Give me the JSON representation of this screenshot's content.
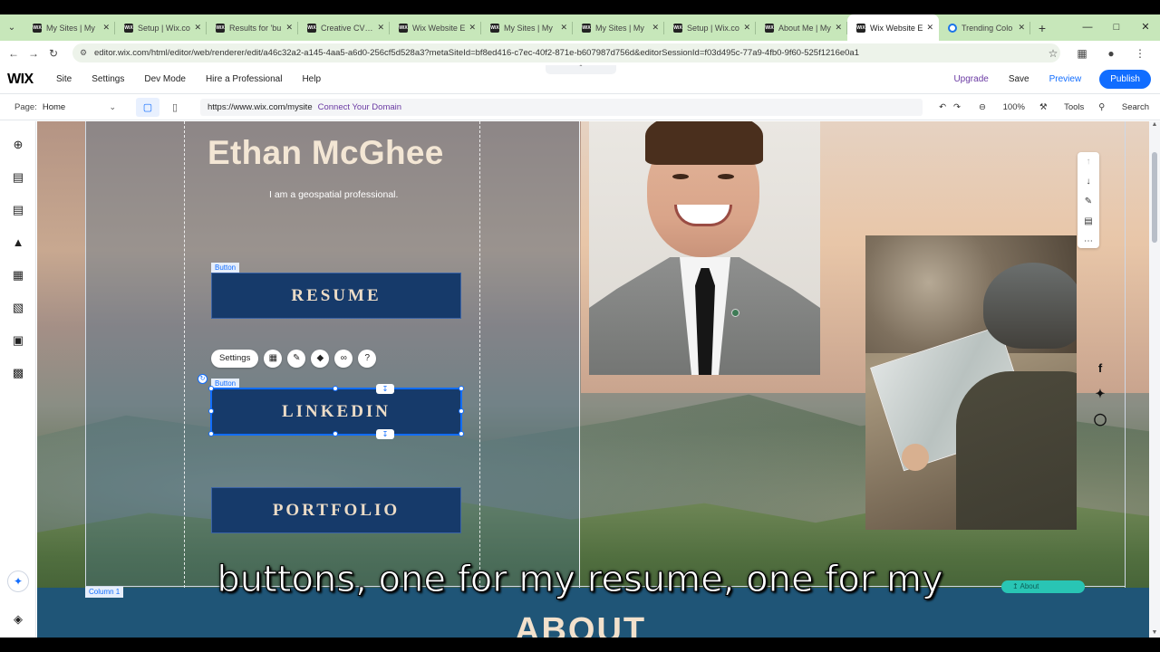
{
  "browser": {
    "tabs": [
      {
        "label": "My Sites | My",
        "fav": "WiX"
      },
      {
        "label": "Setup | Wix.co",
        "fav": "WiX"
      },
      {
        "label": "Results for 'bu",
        "fav": "WiX"
      },
      {
        "label": "Creative CV W",
        "fav": "WiX"
      },
      {
        "label": "Wix Website E",
        "fav": "WiX"
      },
      {
        "label": "My Sites | My",
        "fav": "WiX"
      },
      {
        "label": "My Sites | My",
        "fav": "WiX"
      },
      {
        "label": "Setup | Wix.co",
        "fav": "WiX"
      },
      {
        "label": "About Me | My",
        "fav": "WiX"
      },
      {
        "label": "Wix Website E",
        "fav": "WiX",
        "active": true
      },
      {
        "label": "Trending Colo",
        "fav": ""
      }
    ],
    "url": "editor.wix.com/html/editor/web/renderer/edit/a46c32a2-a145-4aa5-a6d0-256cf5d528a3?metaSiteId=bf8ed416-c7ec-40f2-871e-b607987d756d&editorSessionId=f03d495c-77a9-4fb0-9f60-525f1216e0a1"
  },
  "wix": {
    "logo": "WIX",
    "menu": [
      "Site",
      "Settings",
      "Dev Mode",
      "Hire a Professional",
      "Help"
    ],
    "upgrade": "Upgrade",
    "save": "Save",
    "preview": "Preview",
    "publish": "Publish"
  },
  "pagebar": {
    "page_label": "Page:",
    "page_value": "Home",
    "site_url": "https://www.wix.com/mysite",
    "connect_domain": "Connect Your Domain",
    "zoom": "100%",
    "tools": "Tools",
    "search": "Search"
  },
  "site": {
    "name": "Ethan McGhee",
    "tagline": "I am a geospatial professional.",
    "buttons": {
      "resume": "RESUME",
      "linkedin": "LINKEDIN",
      "portfolio": "PORTFOLIO"
    },
    "element_label_1": "Button",
    "element_label_2": "Button",
    "about_title": "ABOUT",
    "column_label": "Column 1",
    "anchor_label": "About"
  },
  "floating_toolbar": {
    "settings": "Settings"
  },
  "subtitle": "buttons, one for my resume, one for my",
  "colors": {
    "wix_blue": "#116dff",
    "button_fill": "#163a6a",
    "button_text": "#ecdcc7",
    "upgrade_purple": "#6a3aa3"
  }
}
